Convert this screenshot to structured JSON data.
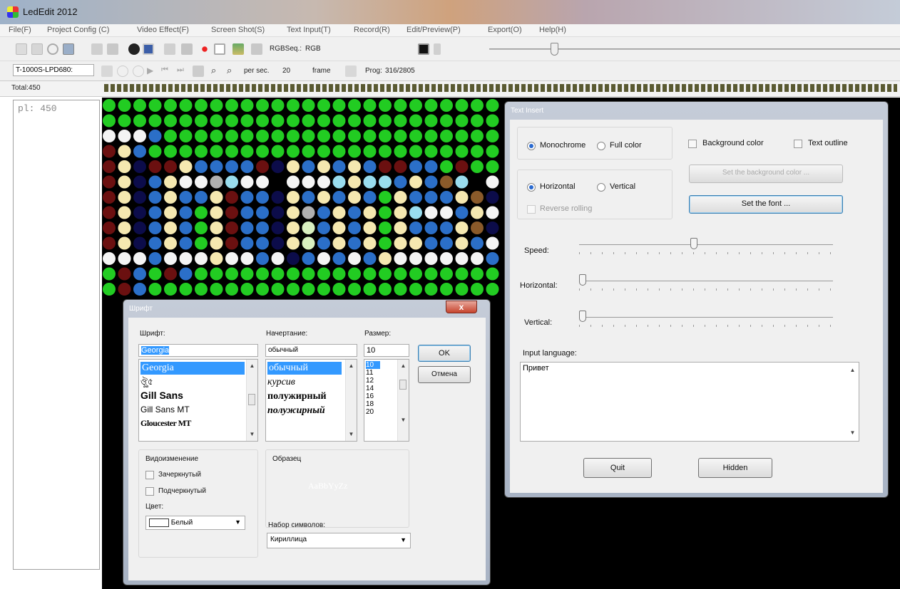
{
  "app": {
    "title": "LedEdit 2012"
  },
  "menu": [
    "File(F)",
    "Project Config (C)",
    "Video Effect(F)",
    "Screen Shot(S)",
    "Text Input(T)",
    "Record(R)",
    "Edit/Preview(P)",
    "Export(O)",
    "Help(H)"
  ],
  "toolbar": {
    "rgbseq_label": "RGBSeq.:",
    "rgbseq_value": "RGB"
  },
  "toolbar2": {
    "controller": "T-1000S-LPD680:",
    "per_sec_label": "per sec.",
    "per_sec_value": "20",
    "frame_label": "frame",
    "prog_label": "Prog:",
    "prog_value": "316/2805"
  },
  "status": {
    "total": "Total:450",
    "pixel_info": "pl:  450"
  },
  "colors": {
    "led_green": "#22cc22",
    "led_blue": "#2b6fc8",
    "led_white": "#f4f4f4",
    "led_cream": "#f5e8b0",
    "led_maroon": "#6b1010",
    "led_navy": "#0c0c4a",
    "led_lightblue": "#99ddee",
    "led_brown": "#8a5a2a",
    "led_purple": "#5a4a9a",
    "led_pale_green": "#d8f0c0",
    "led_gray": "#b0b0b0"
  },
  "text_insert": {
    "title": "Text Insert",
    "monochrome": "Monochrome",
    "full_color": "Full color",
    "background_color": "Background color",
    "text_outline": "Text outline",
    "set_background_color": "Set the background color ...",
    "horizontal": "Horizontal",
    "vertical": "Vertical",
    "reverse_rolling": "Reverse rolling",
    "set_font": "Set the font ...",
    "speed": "Speed:",
    "horizontal_pos": "Horizontal:",
    "vertical_pos": "Vertical:",
    "input_language": "Input language:",
    "input_text": "Привет",
    "quit": "Quit",
    "hidden": "Hidden",
    "speed_fraction": 0.45,
    "horizontal_fraction": 0.0,
    "vertical_fraction": 0.0
  },
  "font_dialog": {
    "title": "Шрифт",
    "close": "x",
    "font_label": "Шрифт:",
    "font_value": "Georgia",
    "fonts": [
      "Georgia",
      "ঔৣ৫",
      "Gill Sans",
      "Gill Sans MT",
      "Gloucester MT"
    ],
    "style_label": "Начертание:",
    "style_value": "обычный",
    "styles": [
      "обычный",
      "курсив",
      "полужирный",
      "полужирный"
    ],
    "size_label": "Размер:",
    "size_value": "10",
    "sizes": [
      "10",
      "11",
      "12",
      "14",
      "16",
      "18",
      "20"
    ],
    "ok": "OK",
    "cancel": "Отмена",
    "effects_label": "Видоизменение",
    "strikeout": "Зачеркнутый",
    "underline": "Подчеркнутый",
    "color_label": "Цвет:",
    "color_value": "Белый",
    "sample_label": "Образец",
    "sample_text": "AaBbYyZz",
    "charset_label": "Набор символов:",
    "charset_value": "Кириллица"
  }
}
